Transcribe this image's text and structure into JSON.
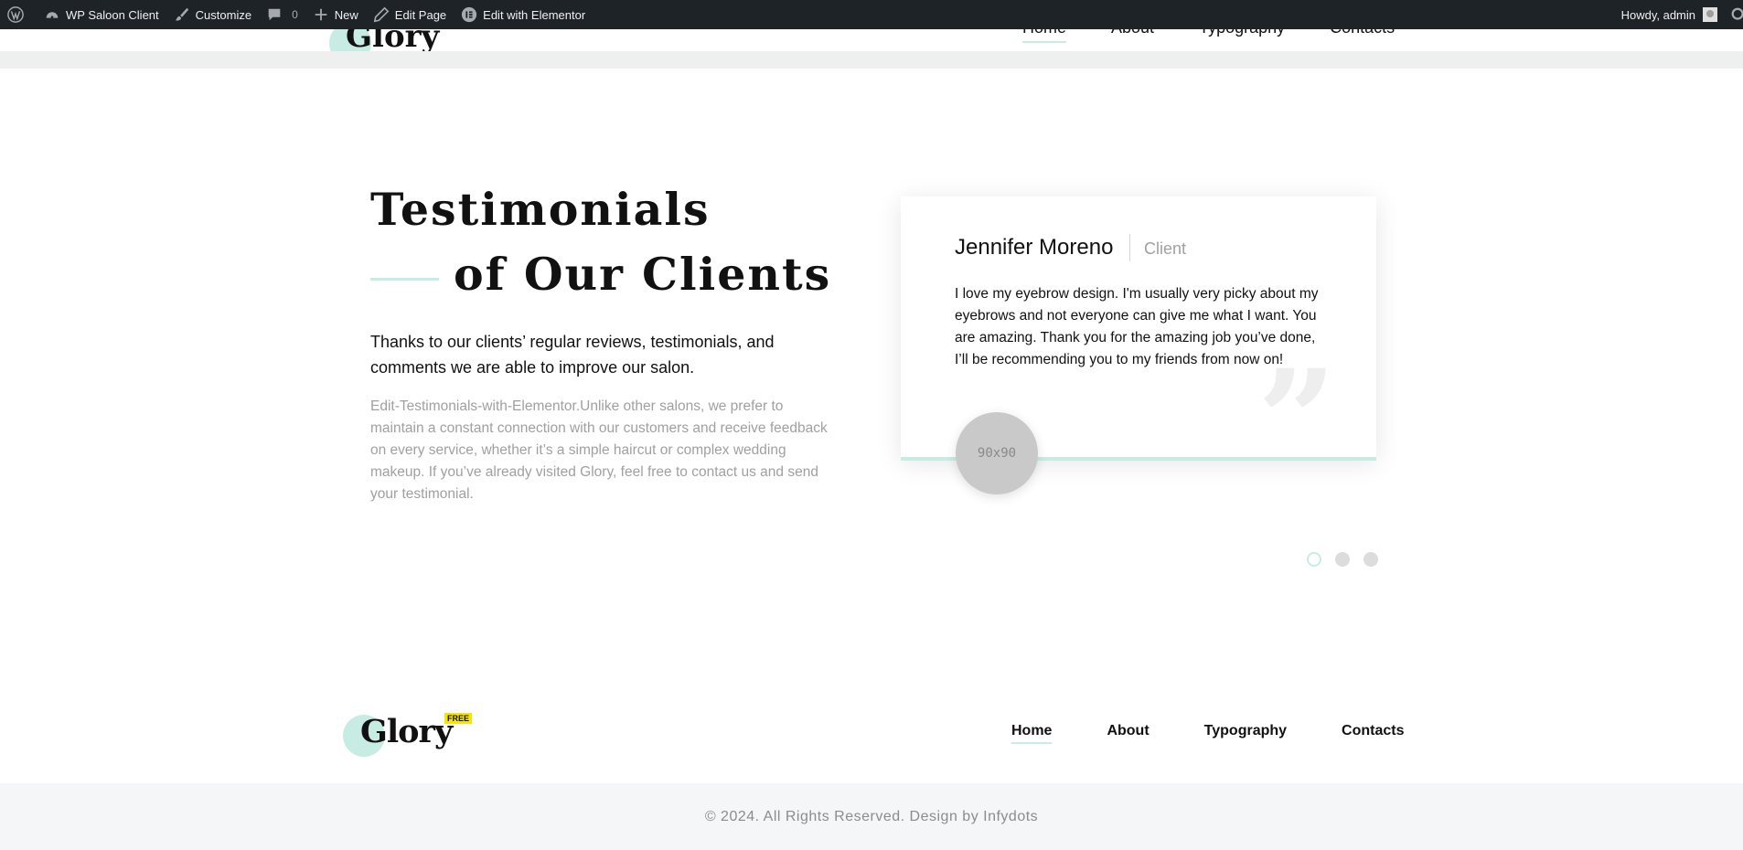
{
  "adminbar": {
    "site_name": "WP Saloon Client",
    "customize": "Customize",
    "comments_count": "0",
    "new": "New",
    "edit_page": "Edit Page",
    "edit_elementor": "Edit with Elementor",
    "howdy": "Howdy, admin"
  },
  "header": {
    "logo": "Glory",
    "nav": [
      "Home",
      "About",
      "Typography",
      "Contacts"
    ]
  },
  "testimonials": {
    "title_line1": "Testimonials",
    "title_line2": "of Our Clients",
    "lead": "Thanks to our clients’ regular reviews, testimonials, and comments we are able to improve our salon.",
    "description": "Edit-Testimonials-with-Elementor.Unlike other salons, we prefer to maintain a constant connection with our customers and receive feedback on every service, whether it’s a simple haircut or complex wedding makeup. If you’ve already visited Glory, feel free to contact us and send your testimonial.",
    "card": {
      "name": "Jennifer Moreno",
      "role": "Client",
      "text": "I love my eyebrow design. I'm usually very picky about my eyebrows and not everyone can give me what I want. You are amazing. Thank you for the amazing job you’ve done, I’ll be recommending you to my friends from now on!",
      "avatar_placeholder": "90x90"
    },
    "slider_active_index": 0
  },
  "footer": {
    "logo": "Glory",
    "badge": "FREE",
    "nav": [
      "Home",
      "About",
      "Typography",
      "Contacts"
    ],
    "copyright": "© 2024. All Rights Reserved. Design by Infydots"
  },
  "colors": {
    "accent": "#c7ece4",
    "adminbar_bg": "#1d2327",
    "badge": "#f7e600"
  }
}
